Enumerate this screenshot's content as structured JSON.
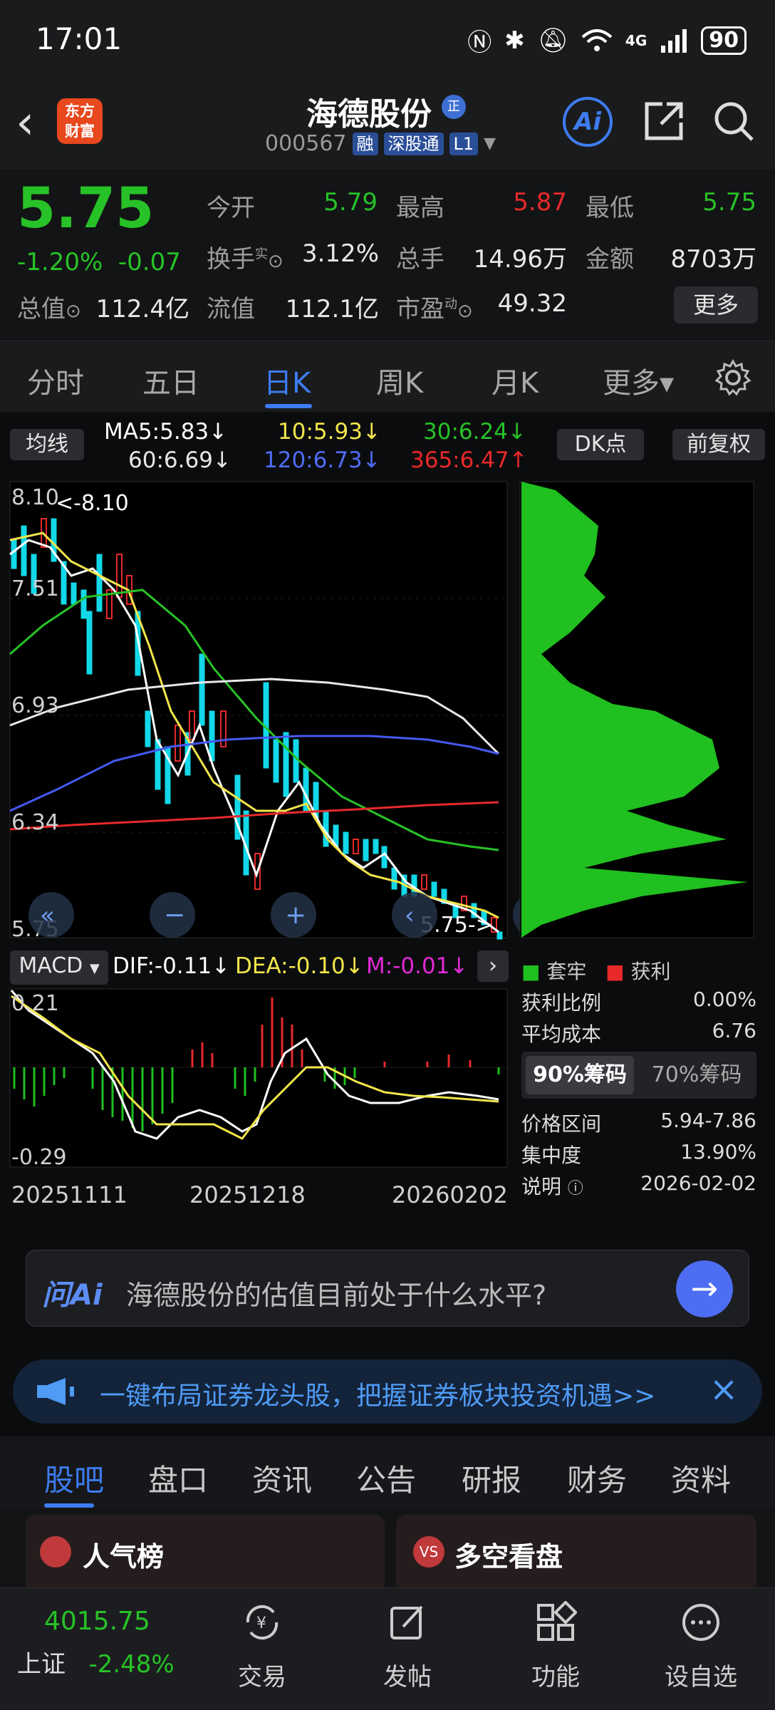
{
  "status_bar": {
    "time": "17:01",
    "battery": "90",
    "net": "4G"
  },
  "header": {
    "back_icon": "back-arrow-icon",
    "logo_text_1": "东方",
    "logo_text_2": "财富",
    "stock_name": "海德股份",
    "badge": "正",
    "code": "000567",
    "tag_rong": "融",
    "tag_shengutong": "深股通",
    "tag_level": "L1",
    "ai_label": "Ai"
  },
  "quote": {
    "price": "5.75",
    "change_pct": "-1.20%",
    "change_abs": "-0.07",
    "open_label": "今开",
    "open": "5.79",
    "high_label": "最高",
    "high": "5.87",
    "low_label": "最低",
    "low": "5.75",
    "turnover_label": "换手",
    "turnover_sup": "实",
    "turnover": "3.12%",
    "volume_label": "总手",
    "volume": "14.96万",
    "amount_label": "金额",
    "amount": "8703万",
    "mktcap_label": "总值",
    "mktcap": "112.4亿",
    "float_label": "流值",
    "float": "112.1亿",
    "pe_label": "市盈",
    "pe_sup": "动",
    "pe": "49.32",
    "more": "更多"
  },
  "period_tabs": [
    "分时",
    "五日",
    "日K",
    "周K",
    "月K",
    "更多▾"
  ],
  "chart_controls": {
    "ma_select": "均线",
    "ma5": "MA5:5.83↓",
    "ma10": "10:5.93↓",
    "ma30": "30:6.24↓",
    "ma60": "60:6.69↓",
    "ma120": "120:6.73↓",
    "ma365": "365:6.47↑",
    "dk": "DK点",
    "adjust": "前复权",
    "y_labels": [
      "8.10",
      "7.51",
      "6.93",
      "6.34",
      "5.75"
    ],
    "max_marker": "<-8.10",
    "last_marker": "5.75->",
    "macd_select": "MACD",
    "dif": "DIF:-0.11↓",
    "dea": "DEA:-0.10↓",
    "m": "M:-0.01↓",
    "macd_top": "0.21",
    "macd_bottom": "-0.29",
    "dates": [
      "20251111",
      "20251218",
      "20260202"
    ],
    "colors": {
      "up": "#e8292a",
      "down": "#12d8e8",
      "ma5": "#ffffff",
      "ma10": "#f2e64a",
      "ma30": "#27c227",
      "ma60": "#e8e8e8",
      "ma120": "#4459f0",
      "ma365": "#e8292a"
    }
  },
  "chip_panel": {
    "legend_trap": "套牢",
    "legend_profit": "获利",
    "rows": [
      {
        "label": "获利比例",
        "value": "0.00%"
      },
      {
        "label": "平均成本",
        "value": "6.76"
      }
    ],
    "tab_90": "90%筹码",
    "tab_70": "70%筹码",
    "rows2": [
      {
        "label": "价格区间",
        "value": "5.94-7.86"
      },
      {
        "label": "集中度",
        "value": "13.90%"
      },
      {
        "label": "说明",
        "value": "2026-02-02"
      }
    ]
  },
  "ai_question": {
    "logo": "问Ai",
    "text": "海德股份的估值目前处于什么水平?"
  },
  "banner": {
    "text": "一键布局证券龙头股，把握证券板块投资机遇>>"
  },
  "bottom_tabs": [
    "股吧",
    "盘口",
    "资讯",
    "公告",
    "研报",
    "财务",
    "资料"
  ],
  "cards": {
    "left": "人气榜",
    "right": "多空看盘"
  },
  "bottom_nav": {
    "index_value": "4015.75",
    "index_name": "上证",
    "index_change": "-2.48%",
    "items": [
      "交易",
      "发帖",
      "功能",
      "设自选"
    ]
  }
}
